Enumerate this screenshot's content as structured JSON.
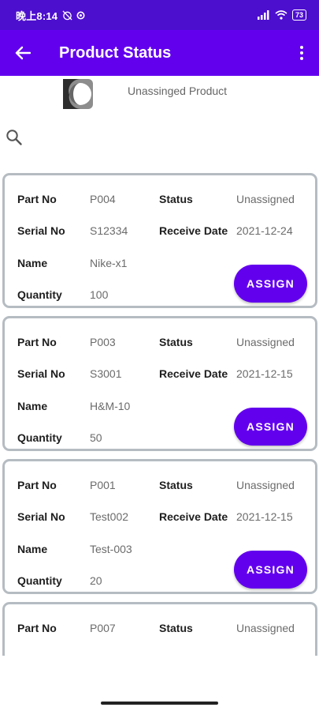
{
  "status_bar": {
    "time": "晚上8:14",
    "battery": "73"
  },
  "app_bar": {
    "title": "Product Status"
  },
  "header": {
    "label": "Unassinged Product"
  },
  "labels": {
    "part_no": "Part No",
    "serial_no": "Serial No",
    "name": "Name",
    "quantity": "Quantity",
    "status": "Status",
    "receive_date": "Receive Date",
    "assign_button": "ASSIGN"
  },
  "products": [
    {
      "part_no": "P004",
      "serial_no": "S12334",
      "name": "Nike-x1",
      "quantity": "100",
      "status": "Unassigned",
      "receive_date": "2021-12-24"
    },
    {
      "part_no": "P003",
      "serial_no": "S3001",
      "name": "H&M-10",
      "quantity": "50",
      "status": "Unassigned",
      "receive_date": "2021-12-15"
    },
    {
      "part_no": "P001",
      "serial_no": "Test002",
      "name": "Test-003",
      "quantity": "20",
      "status": "Unassigned",
      "receive_date": "2021-12-15"
    },
    {
      "part_no": "P007",
      "status": "Unassigned"
    }
  ],
  "colors": {
    "primary": "#6200ee",
    "status_bar": "#4d0fce",
    "card_border": "#b5bcc2"
  }
}
